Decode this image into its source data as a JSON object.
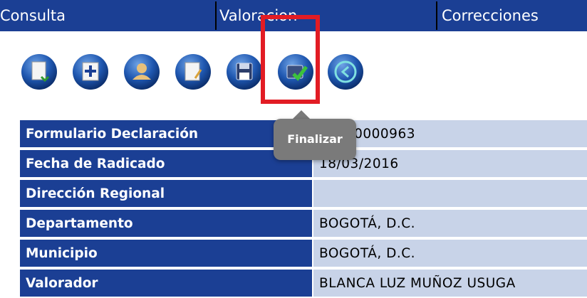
{
  "tabs": [
    {
      "label": "Consulta"
    },
    {
      "label": "Valoracion"
    },
    {
      "label": "Correcciones"
    }
  ],
  "toolbar": {
    "buttons": [
      {
        "icon": "document-export-icon"
      },
      {
        "icon": "add-icon"
      },
      {
        "icon": "user-icon"
      },
      {
        "icon": "edit-document-icon"
      },
      {
        "icon": "save-icon"
      },
      {
        "icon": "finalize-check-icon"
      },
      {
        "icon": "back-arrow-icon"
      }
    ],
    "tooltip": "Finalizar"
  },
  "form": {
    "rows": [
      {
        "label": "Formulario Declaración",
        "value": "CF000000963"
      },
      {
        "label": "Fecha de Radicado",
        "value": "18/03/2016"
      },
      {
        "label": "Dirección Regional",
        "value": ""
      },
      {
        "label": "Departamento",
        "value": "BOGOTÁ, D.C."
      },
      {
        "label": "Municipio",
        "value": "BOGOTÁ, D.C."
      },
      {
        "label": "Valorador",
        "value": "BLANCA LUZ MUÑOZ USUGA"
      }
    ]
  },
  "colors": {
    "header_bg": "#1b3f94",
    "value_bg": "#c8d3e8",
    "highlight": "#e21c24",
    "tooltip_bg": "#7a7a7a"
  }
}
